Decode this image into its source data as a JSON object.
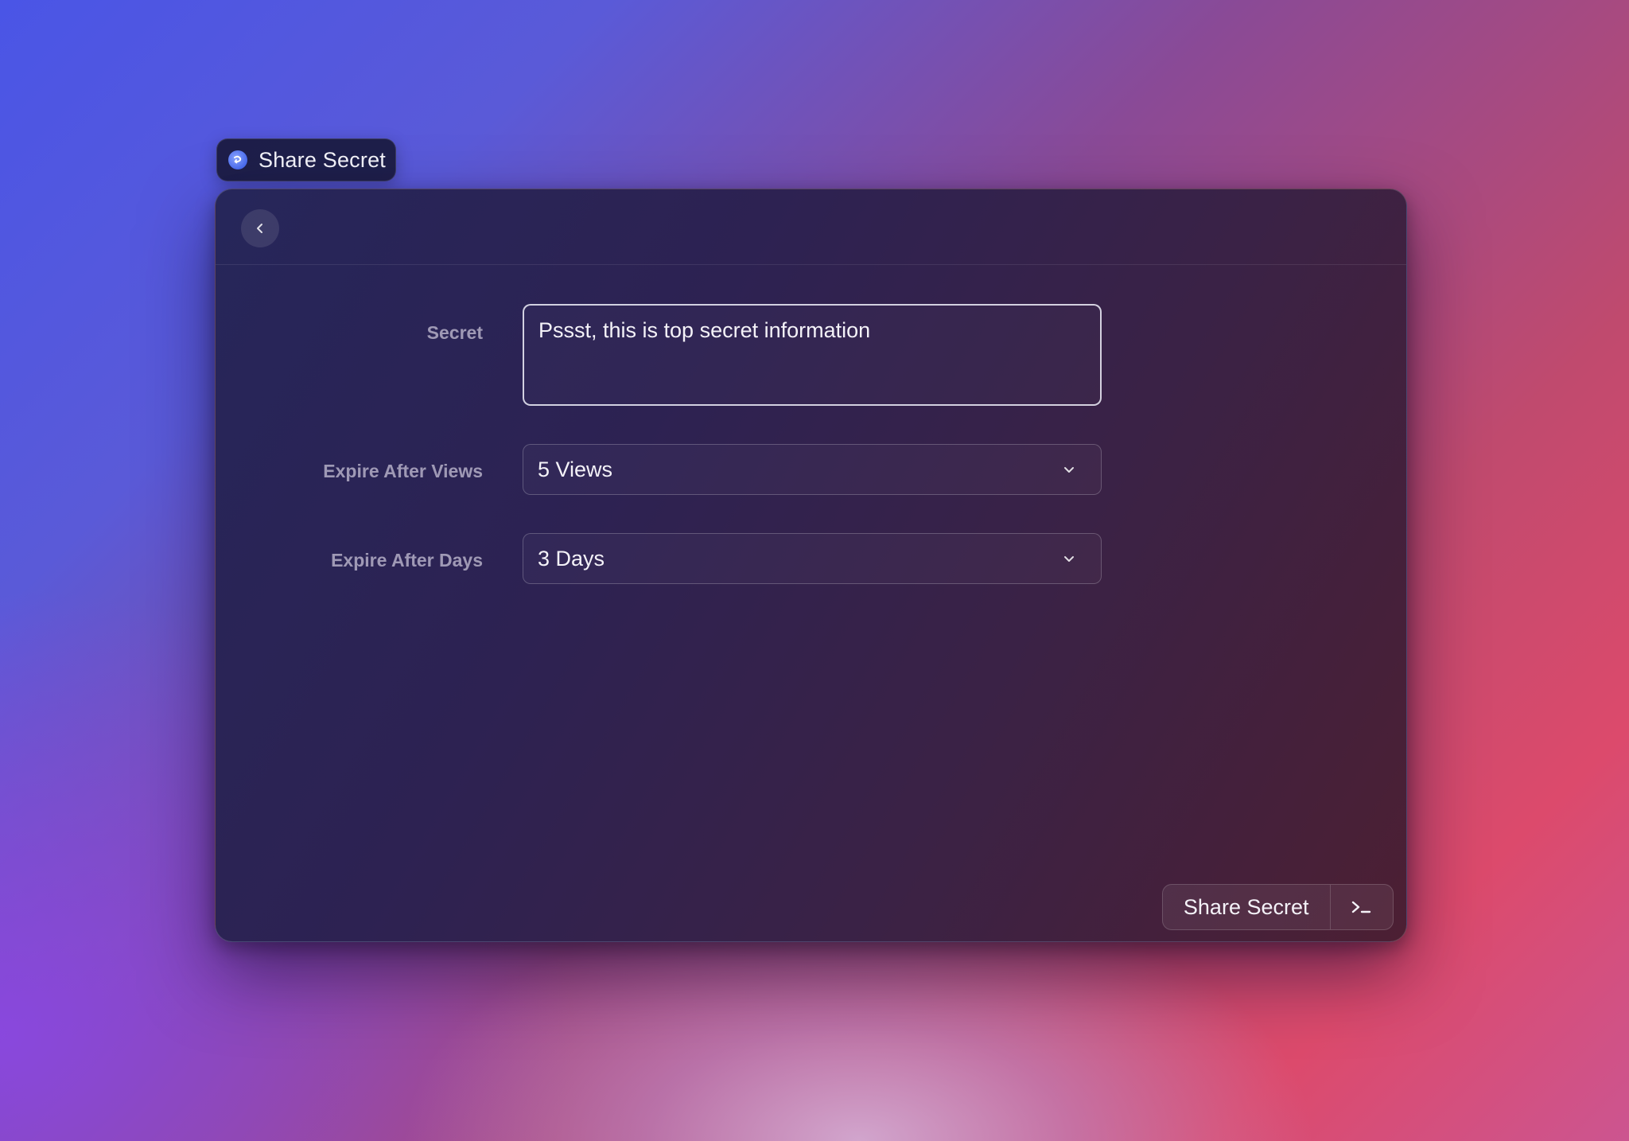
{
  "app": {
    "title": "Share Secret",
    "icon": "share-secret-app-icon"
  },
  "header": {
    "back_icon": "chevron-left-icon"
  },
  "form": {
    "secret": {
      "label": "Secret",
      "value": "Pssst, this is top secret information"
    },
    "expire_views": {
      "label": "Expire After Views",
      "selected": "5 Views"
    },
    "expire_days": {
      "label": "Expire After Days",
      "selected": "3 Days"
    }
  },
  "actions": {
    "primary_label": "Share Secret",
    "secondary_icon": "terminal-prompt-icon"
  },
  "colors": {
    "window_bg_start": "#26265a",
    "window_bg_end": "#4c1f33",
    "accent_icon": "#4a6cf0",
    "text_primary": "#f4f2f8"
  }
}
